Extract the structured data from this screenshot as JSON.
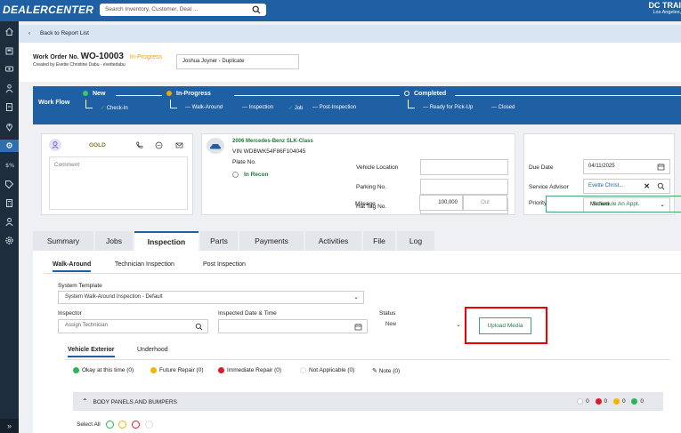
{
  "topbar": {
    "logo": "DEALERCENTER",
    "search_placeholder": "Search Inventory, Customer, Deal ...",
    "dealer_name": "DC TRAI",
    "dealer_location": "Los Angeles,"
  },
  "sidebar": {
    "items": [
      "home-icon",
      "car-icon",
      "money-icon",
      "person-icon",
      "document-icon",
      "map-pin-icon",
      "gear-wrench-icon",
      "price-tag-icon",
      "tag-icon",
      "calculator-icon",
      "user-icon",
      "settings-icon"
    ],
    "expand": "»"
  },
  "back": {
    "label": "Back to Report List",
    "chevron": "‹"
  },
  "work_order": {
    "prefix": "Work Order No.",
    "number": "WO-10003",
    "status": "In-Progress",
    "created_by": "Created by Evette Christine Dabu - evettedabu",
    "customer": "Joshua Joyner - Duplicate"
  },
  "workflow": {
    "label": "Work Flow",
    "stages": [
      {
        "name": "New",
        "color": "#3fc46a"
      },
      {
        "name": "In-Progress",
        "color": "#f5a200"
      },
      {
        "name": "Completed",
        "color": "#ffffff"
      }
    ],
    "new_steps": [
      "Check-In"
    ],
    "progress_steps": [
      "Walk-Around",
      "Inspection",
      "Job",
      "Post-Inspection"
    ],
    "completed_steps": [
      "Ready for Pick-Up",
      "Closed"
    ]
  },
  "customer_card": {
    "tier": "GOLD",
    "comment_placeholder": "Comment"
  },
  "vehicle": {
    "title": "2006 Mercedes-Benz SLK-Class",
    "vin": "VIN WDBWK54F86F104045",
    "plate": "Plate No.",
    "in_recon": "In Recon",
    "fields": {
      "vehicle_location": "Vehicle Location",
      "parking_no": "Parking No.",
      "hat_tag_no": "Hat Tag No.",
      "mileage": "Mileage",
      "mileage_value": "100,000",
      "mileage_unit": "Out"
    }
  },
  "schedule": {
    "due_date_label": "Due Date",
    "due_date": "04/11/2025",
    "advisor_label": "Service Advisor",
    "advisor": "Evette Christ...",
    "priority_label": "Priority",
    "priority": "Medium",
    "appointment_button": "Schedule An Appt."
  },
  "tabs": [
    "Summary",
    "Jobs",
    "Inspection",
    "Parts",
    "Payments",
    "Activities",
    "File",
    "Log"
  ],
  "subtabs": [
    "Walk-Around",
    "Technician Inspection",
    "Post Inspection"
  ],
  "inspection": {
    "template_label": "System Template",
    "template_value": "System Walk-Around Inspection - Default",
    "inspector_label": "Inspector",
    "inspector_placeholder": "Assign Technician",
    "date_label": "Inspected Date & Time",
    "status_label": "Status",
    "status_value": "New",
    "upload_button": "Upload Media"
  },
  "view_tabs": [
    "Vehicle Exterior",
    "Underhood"
  ],
  "legend": [
    {
      "label": "Okay at this time (0)",
      "color": "#2fb35a"
    },
    {
      "label": "Future Repair (0)",
      "color": "#f5b400"
    },
    {
      "label": "Immediate Repair (0)",
      "color": "#e0182b"
    },
    {
      "label": "Not Applicable (0)",
      "color": "#ffffff"
    },
    {
      "label": "Note (0)",
      "color": "note"
    }
  ],
  "section": {
    "title": "BODY PANELS AND BUMPERS",
    "counts": [
      "0",
      "0",
      "0",
      "0"
    ]
  },
  "select_all": "Select All"
}
